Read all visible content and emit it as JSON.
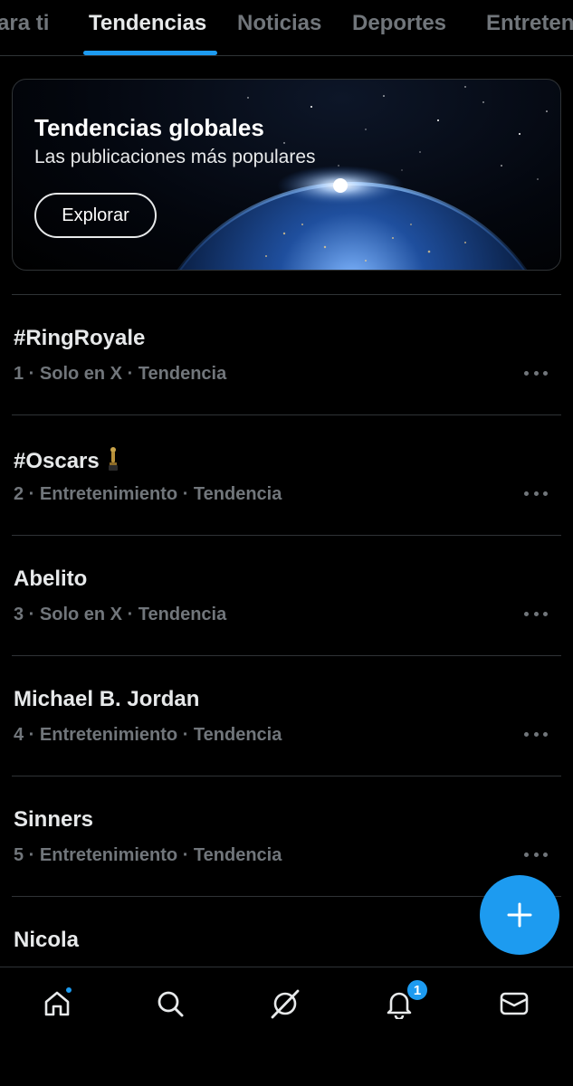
{
  "tabs": [
    {
      "label": "ara ti",
      "active": false
    },
    {
      "label": "Tendencias",
      "active": true
    },
    {
      "label": "Noticias",
      "active": false
    },
    {
      "label": "Deportes",
      "active": false
    },
    {
      "label": "Entreten",
      "active": false
    }
  ],
  "banner": {
    "title": "Tendencias globales",
    "subtitle": "Las publicaciones más populares",
    "button_label": "Explorar"
  },
  "trends": [
    {
      "title": "#RingRoyale",
      "meta": "1 · Solo en X · Tendencia"
    },
    {
      "title": "#Oscars",
      "emoji": "oscar-trophy-icon",
      "meta": "2 · Entretenimiento · Tendencia"
    },
    {
      "title": "Abelito",
      "meta": "3 · Solo en X · Tendencia"
    },
    {
      "title": "Michael B. Jordan",
      "meta": "4 · Entretenimiento · Tendencia"
    },
    {
      "title": "Sinners",
      "meta": "5 · Entretenimiento · Tendencia"
    },
    {
      "title": "Nicola",
      "meta": ""
    }
  ],
  "bottom_nav": {
    "items": [
      "home-icon",
      "search-icon",
      "grok-icon",
      "bell-icon",
      "mail-icon"
    ],
    "notifications_badge": "1",
    "home_has_dot": true
  },
  "fab": {
    "icon": "plus-icon"
  },
  "colors": {
    "accent": "#1d9bf0",
    "background": "#000000",
    "muted": "#71767b",
    "text": "#e7e9ea",
    "border": "#2f3336"
  }
}
